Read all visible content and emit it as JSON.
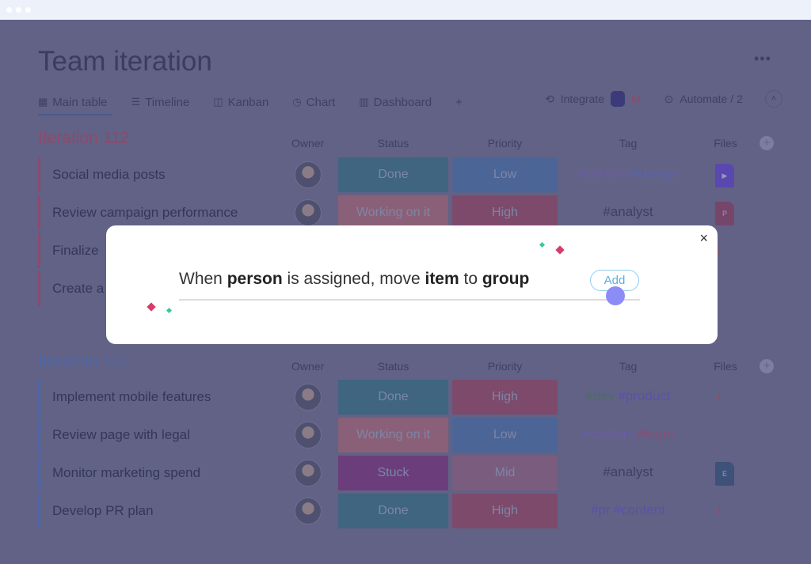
{
  "window": {
    "title": "Team iteration",
    "more_label": "•••"
  },
  "tabs": [
    {
      "label": "Main table",
      "icon": "table-icon",
      "glyph": "▦"
    },
    {
      "label": "Timeline",
      "icon": "timeline-icon",
      "glyph": "☰"
    },
    {
      "label": "Kanban",
      "icon": "kanban-icon",
      "glyph": "◫"
    },
    {
      "label": "Chart",
      "icon": "chart-icon",
      "glyph": "◷"
    },
    {
      "label": "Dashboard",
      "icon": "dashboard-icon",
      "glyph": "▥"
    }
  ],
  "add_tab": "+",
  "tools": {
    "integrate": "Integrate",
    "automate": "Automate / 2",
    "collapse": "˄"
  },
  "columns": {
    "owner": "Owner",
    "status": "Status",
    "priority": "Priority",
    "tag": "Tag",
    "files": "Files"
  },
  "colors": {
    "done": "#3f6580",
    "working": "#8a6078",
    "stuck": "#6b3d7b",
    "high": "#7d4a6c",
    "low": "#4c6597",
    "mid": "#7a5c7f",
    "group1": "#8a4b6e",
    "group2": "#4e66a8"
  },
  "groups": [
    {
      "title": "Iteration 112",
      "color": "#8a4b6e",
      "rows": [
        {
          "name": "Social media posts",
          "status": "Done",
          "status_color": "#3f6580",
          "priority": "Low",
          "priority_color": "#4c6597",
          "tags": [
            {
              "t": "#content",
              "c": "#6b5ba8"
            },
            {
              "t": "#design",
              "c": "#5a62b0"
            }
          ],
          "file": "video",
          "file_label": "▶",
          "file_color": "#5a47b0"
        },
        {
          "name": "Review campaign performance",
          "status": "Working on it",
          "status_color": "#8a6078",
          "priority": "High",
          "priority_color": "#7d4a6c",
          "tags": [
            {
              "t": "#analyst",
              "c": "#3e4066"
            }
          ],
          "file": "ppt",
          "file_label": "P",
          "file_color": "#76466a"
        },
        {
          "name": "Finalize",
          "status": "",
          "priority": "",
          "tags": [],
          "file": "monday",
          "file_label": "//"
        },
        {
          "name": "Create a",
          "status": "",
          "priority": "",
          "tags": [],
          "file": "",
          "file_label": ""
        }
      ]
    },
    {
      "title": "Iteration 111",
      "color": "#4e66a8",
      "rows": [
        {
          "name": "Implement mobile features",
          "status": "Done",
          "status_color": "#3f6580",
          "priority": "High",
          "priority_color": "#7d4a6c",
          "tags": [
            {
              "t": "#dev",
              "c": "#4f6a6a"
            },
            {
              "t": "#product",
              "c": "#5a52a8"
            }
          ],
          "file": "monday",
          "file_label": "//"
        },
        {
          "name": "Review page with legal",
          "status": "Working on it",
          "status_color": "#8a6078",
          "priority": "Low",
          "priority_color": "#4c6597",
          "tags": [
            {
              "t": "#content",
              "c": "#6b5ba8"
            },
            {
              "t": "#legal",
              "c": "#85507a"
            }
          ],
          "file": "",
          "file_label": ""
        },
        {
          "name": "Monitor marketing spend",
          "status": "Stuck",
          "status_color": "#6b3d7b",
          "priority": "Mid",
          "priority_color": "#7a5c7f",
          "tags": [
            {
              "t": "#analyst",
              "c": "#3e4066"
            }
          ],
          "file": "doc",
          "file_label": "E",
          "file_color": "#3e5178"
        },
        {
          "name": "Develop PR plan",
          "status": "Done",
          "status_color": "#3f6580",
          "priority": "High",
          "priority_color": "#7d4a6c",
          "tags": [
            {
              "t": "#pr",
              "c": "#5a52a8"
            },
            {
              "t": "#content",
              "c": "#5a52a8"
            }
          ],
          "file": "monday",
          "file_label": "//"
        }
      ]
    }
  ],
  "modal": {
    "w1": "When ",
    "b1": "person",
    "w2": " is assigned, move ",
    "b2": "item",
    "w3": " to ",
    "b3": "group",
    "add": "Add",
    "close": "×"
  }
}
